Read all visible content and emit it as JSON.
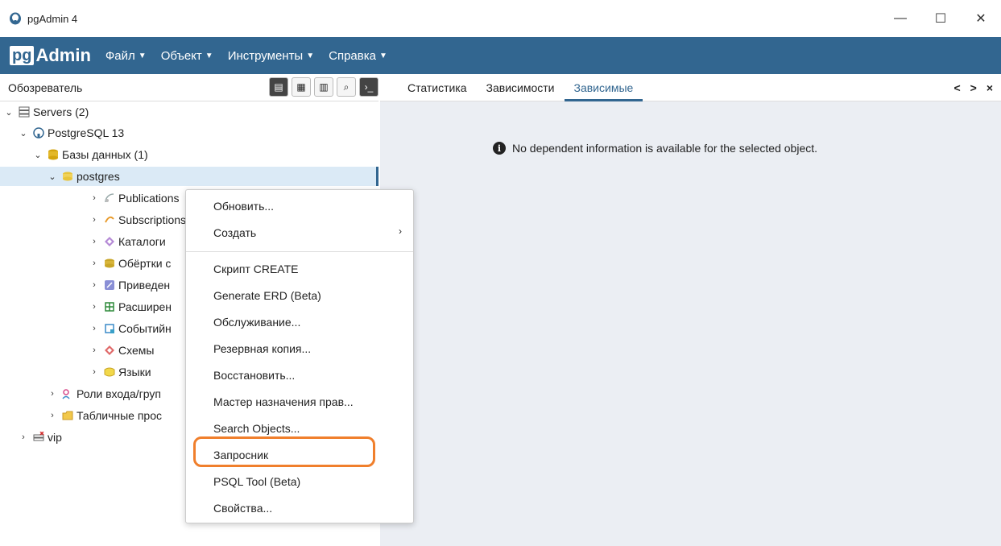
{
  "window": {
    "title": "pgAdmin 4",
    "minimize": "—",
    "maximize": "☐",
    "close": "✕"
  },
  "menubar": {
    "logo_pg": "pg",
    "logo_admin": "Admin",
    "items": [
      "Файл",
      "Объект",
      "Инструменты",
      "Справка"
    ]
  },
  "browser": {
    "label": "Обозреватель"
  },
  "tree": {
    "servers": "Servers (2)",
    "pg13": "PostgreSQL 13",
    "databases": "Базы данных (1)",
    "postgres": "postgres",
    "publications": "Publications",
    "subscriptions": "Subscriptions",
    "catalogs": "Каталоги",
    "fdw": "Обёртки с",
    "casts": "Приведен",
    "extensions": "Расширен",
    "event_triggers": "Событийн",
    "schemas": "Схемы",
    "languages": "Языки",
    "roles": "Роли входа/груп",
    "tablespaces": "Табличные прос",
    "vip": "vip"
  },
  "tabs": [
    "Статистика",
    "Зависимости",
    "Зависимые"
  ],
  "tab_nav": [
    "<",
    ">",
    "×"
  ],
  "notice": "No dependent information is available for the selected object.",
  "context_menu": {
    "refresh": "Обновить...",
    "create": "Создать",
    "create_script": "Скрипт CREATE",
    "erd": "Generate ERD (Beta)",
    "maintenance": "Обслуживание...",
    "backup": "Резервная копия...",
    "restore": "Восстановить...",
    "grant": "Мастер назначения прав...",
    "search": "Search Objects...",
    "query": "Запросник",
    "psql": "PSQL Tool (Beta)",
    "properties": "Свойства..."
  },
  "colors": {
    "brand": "#326690",
    "highlight": "#f07f2c",
    "selected": "#dbeaf6"
  }
}
